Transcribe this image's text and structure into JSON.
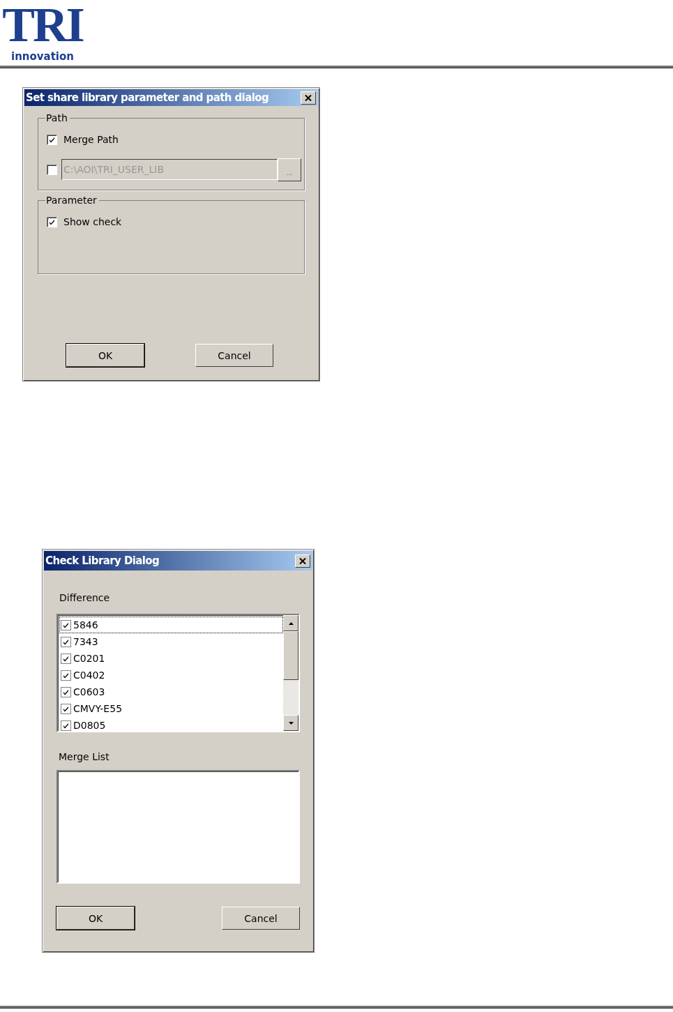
{
  "header": {
    "logo": {
      "mark": "TRI",
      "tagline": "innovation"
    }
  },
  "dialogs": [
    {
      "kind": "path",
      "title": "Set share library parameter and path dialog",
      "groups": [
        {
          "label": "Path",
          "rows": [
            {
              "kind": "checkbox",
              "label": "Merge Path",
              "checked": true
            },
            {
              "kind": "pathfield",
              "checked": false,
              "value": "C:\\AOI\\TRI_USER_LIB",
              "disabled": true,
              "browse": "..."
            }
          ]
        },
        {
          "label": "Parameter",
          "rows": [
            {
              "kind": "checkbox",
              "label": "Show check",
              "checked": true
            }
          ]
        }
      ],
      "buttons": [
        {
          "label": "OK",
          "default": true
        },
        {
          "label": "Cancel",
          "default": false
        }
      ]
    },
    {
      "kind": "check",
      "title": "Check Library Dialog",
      "difference_label": "Difference",
      "items": [
        {
          "label": "5846",
          "checked": true,
          "focused": true
        },
        {
          "label": "7343",
          "checked": true,
          "focused": false
        },
        {
          "label": "C0201",
          "checked": true,
          "focused": false
        },
        {
          "label": "C0402",
          "checked": true,
          "focused": false
        },
        {
          "label": "C0603",
          "checked": true,
          "focused": false
        },
        {
          "label": "CMVY-E55",
          "checked": true,
          "focused": false
        },
        {
          "label": "D0805",
          "checked": true,
          "focused": false
        }
      ],
      "merge_label": "Merge List",
      "buttons": [
        {
          "label": "OK",
          "default": true
        },
        {
          "label": "Cancel",
          "default": false
        }
      ]
    }
  ]
}
